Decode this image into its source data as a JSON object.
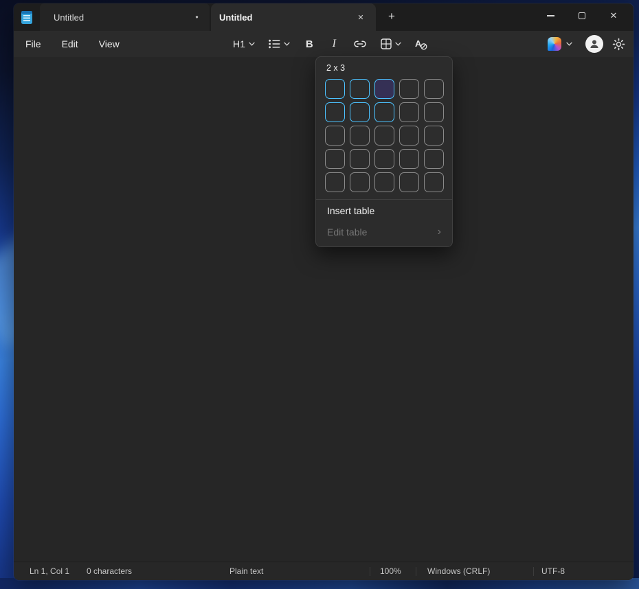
{
  "colors": {
    "accent": "#4cc2ff",
    "selection_hover_fill": "#353055",
    "window_bg": "#262626"
  },
  "titlebar": {
    "tabs": [
      {
        "label": "Untitled",
        "unsaved": true,
        "active": false
      },
      {
        "label": "Untitled",
        "unsaved": false,
        "active": true
      }
    ]
  },
  "icons": {
    "close_glyph": "✕",
    "add_tab_glyph": "+",
    "chevron_right_glyph": "›",
    "unsaved_dot_glyph": "●"
  },
  "menubar": {
    "items": [
      {
        "label": "File"
      },
      {
        "label": "Edit"
      },
      {
        "label": "View"
      }
    ]
  },
  "toolbar": {
    "heading_label": "H1",
    "bold_label": "B",
    "italic_label": "I"
  },
  "table_picker": {
    "size_label": "2 x 3",
    "grid": {
      "rows": 5,
      "cols": 5,
      "selected_rows": 2,
      "selected_cols": 3,
      "hover_row": 1,
      "hover_col": 3
    },
    "insert_label": "Insert table",
    "edit_label": "Edit table",
    "edit_enabled": false
  },
  "statusbar": {
    "cursor_position": "Ln 1, Col 1",
    "character_count": "0 characters",
    "document_format": "Plain text",
    "zoom_level": "100%",
    "line_ending": "Windows (CRLF)",
    "encoding": "UTF-8"
  }
}
